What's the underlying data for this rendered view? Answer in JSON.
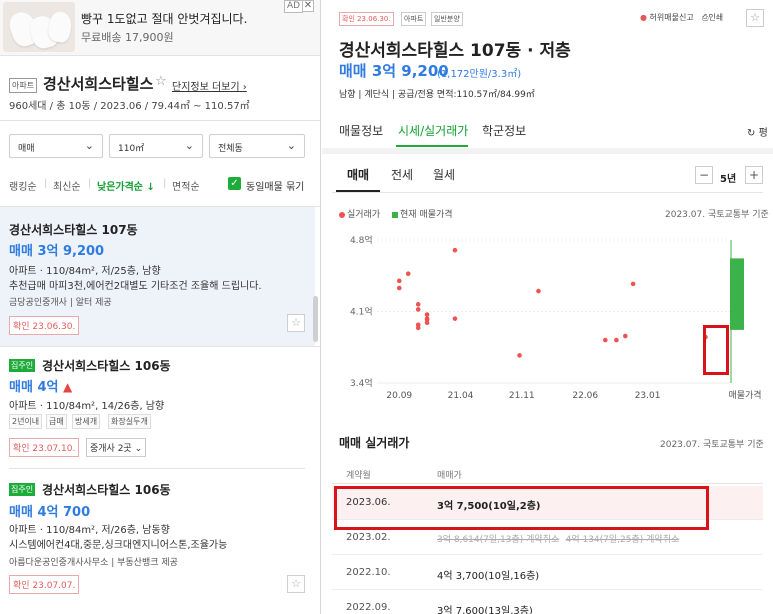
{
  "ad": {
    "title": "빵꾸 1도없고 절대 안벗겨집니다.",
    "subtitle": "무료배송 17,900원",
    "badge": "AD",
    "close": "✕"
  },
  "complex": {
    "tag": "아파트",
    "name": "경산서희스타힐스",
    "more": "단지정보 더보기",
    "meta": "960세대 / 총 10동 / 2023.06 / 79.44㎡ ~ 110.57㎡"
  },
  "filters": {
    "deal": "매매",
    "area": "110㎡",
    "dong": "전체동"
  },
  "sort": {
    "items": [
      "랭킹순",
      "최신순",
      "낮은가격순 ↓",
      "면적순"
    ],
    "active_index": 2,
    "same_listing": "동일매물 묶기"
  },
  "listings": [
    {
      "title": "경산서희스타힐스 107동",
      "price": "매매 3억 9,200",
      "spec": "아파트 · 110/84m², 저/25층, 남향",
      "desc": "추천급매 마피3천,에어컨2대별도 기타조건 조율해 드립니다.",
      "agent": "금당공인중개사 | 알터 제공",
      "confirmed": "확인 23.06.30."
    },
    {
      "owner_badge": "집주인",
      "title": "경산서희스타힐스 106동",
      "price": "매매 4억",
      "spec": "아파트 · 110/84m², 14/26층, 남향",
      "chips": [
        "2년이내",
        "급매",
        "방세개",
        "화장실두개"
      ],
      "confirmed": "확인 23.07.10.",
      "agents": "중개사 2곳"
    },
    {
      "owner_badge": "집주인",
      "title": "경산서희스타힐스 106동",
      "price": "매매 4억 700",
      "spec": "아파트 · 110/84m², 저/26층, 남동향",
      "desc": "시스템에어컨4대,중문,싱크대엔지니어스톤,조율가능",
      "agent": "아름다운공인중개사사무소 | 부동산뱅크 제공",
      "confirmed": "확인 23.07.07."
    }
  ],
  "detail": {
    "tags": [
      "확인 23.06.30.",
      "아파트",
      "일반분양"
    ],
    "report": "허위매물신고",
    "print": "인쇄",
    "title": "경산서희스타힐스 107동 · 저층",
    "price": "매매 3억 9,200",
    "price_sub": "(1,172만원/3.3㎡)",
    "info": "남향 | 계단식 | 공급/전용 면적:110.57㎡/84.99㎡",
    "tabs": [
      "매물정보",
      "시세/실거래가",
      "학군정보"
    ],
    "active_tab": 1,
    "pyeong": "평",
    "sub_tabs": [
      "매매",
      "전세",
      "월세"
    ],
    "period": "5년",
    "legend_real": "실거래가",
    "legend_current": "현재 매물가격",
    "source": "2023.07. 국토교통부 기준",
    "colors": {
      "real": "#f05252",
      "current": "#3bb34a"
    }
  },
  "chart_data": {
    "type": "scatter",
    "y_ticks": [
      "4.8억",
      "4.1억",
      "3.4억"
    ],
    "x_ticks": [
      "20.09",
      "21.04",
      "21.11",
      "22.06",
      "23.01",
      "매물가격"
    ],
    "ylim": [
      3.4,
      4.8
    ],
    "series": [
      {
        "name": "실거래가",
        "points": [
          [
            2020.75,
            4.4
          ],
          [
            2020.75,
            4.33
          ],
          [
            2020.83,
            4.47
          ],
          [
            2020.92,
            4.17
          ],
          [
            2020.92,
            4.12
          ],
          [
            2020.92,
            3.94
          ],
          [
            2020.92,
            3.97
          ],
          [
            2021.0,
            4.07
          ],
          [
            2021.0,
            4.03
          ],
          [
            2021.0,
            4.02
          ],
          [
            2021.0,
            3.99
          ],
          [
            2021.25,
            4.7
          ],
          [
            2021.25,
            4.03
          ],
          [
            2021.83,
            3.67
          ],
          [
            2022.0,
            4.3
          ],
          [
            2022.6,
            3.82
          ],
          [
            2022.7,
            3.82
          ],
          [
            2022.78,
            3.86
          ],
          [
            2022.85,
            4.37
          ],
          [
            2023.5,
            3.85
          ]
        ]
      },
      {
        "name": "현재 매물가격",
        "range": [
          3.92,
          4.62
        ]
      }
    ]
  },
  "deals": {
    "title": "매매 실거래가",
    "source": "2023.07. 국토교통부 기준",
    "col_date": "계약월",
    "col_price": "매매가",
    "rows": [
      {
        "date": "2023.06.",
        "price": "3억 7,500(10일,2층)"
      },
      {
        "date": "2023.02.",
        "price": "3억 8,614(7일,13층) 계약취소",
        "price2": "4억 134(7일,25층) 계약취소"
      },
      {
        "date": "2022.10.",
        "price": "4억 3,700(10일,16층)"
      },
      {
        "date": "2022.09.",
        "price": "3억 7,600(13일,3층)"
      }
    ]
  }
}
